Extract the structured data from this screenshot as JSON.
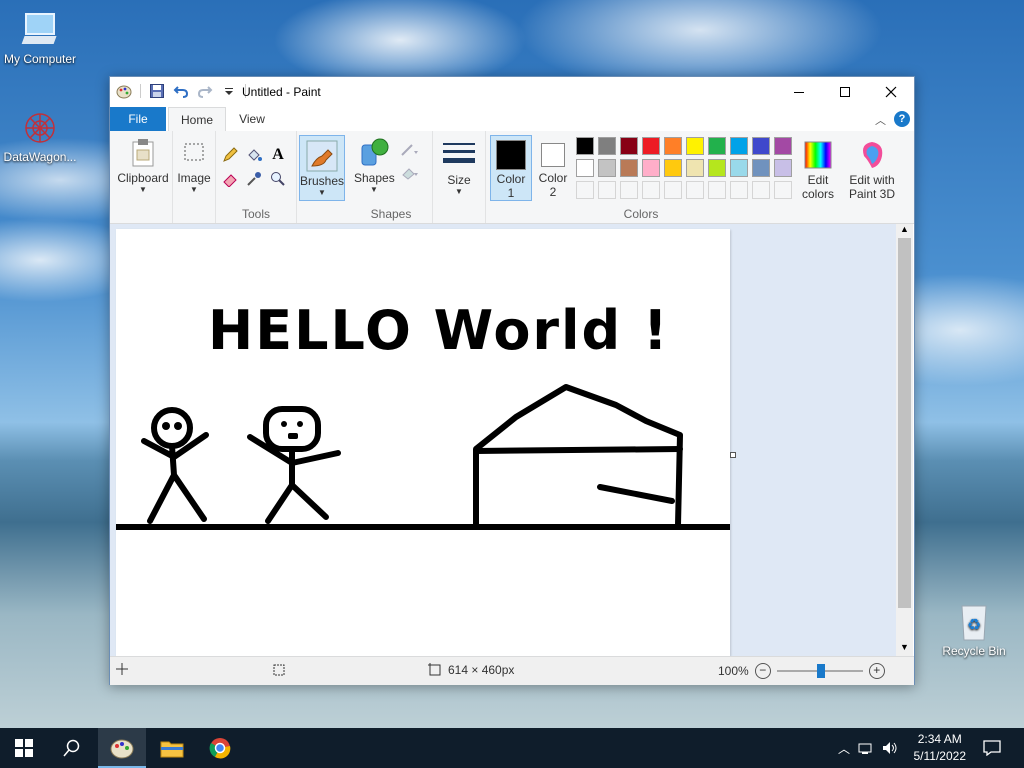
{
  "desktop": {
    "icons": [
      {
        "label": "My Computer"
      },
      {
        "label": "DataWagon..."
      },
      {
        "label": "Recycle Bin"
      }
    ]
  },
  "window": {
    "title": "Untitled - Paint",
    "tabs": [
      "File",
      "Home",
      "View"
    ],
    "ribbon": {
      "clipboard": "Clipboard",
      "image": "Image",
      "tools_label": "Tools",
      "brushes": "Brushes",
      "shapes": "Shapes",
      "shapes_group": "Shapes",
      "size": "Size",
      "color1": "Color\n1",
      "color1_a": "Color",
      "color1_b": "1",
      "color2_a": "Color",
      "color2_b": "2",
      "edit_colors_a": "Edit",
      "edit_colors_b": "colors",
      "edit3d_a": "Edit with",
      "edit3d_b": "Paint 3D",
      "colors_group": "Colors",
      "color1_value": "#000000",
      "color2_value": "#ffffff",
      "palette_row1": [
        "#000000",
        "#7f7f7f",
        "#880015",
        "#ed1c24",
        "#ff7f27",
        "#fff200",
        "#22b14c",
        "#00a2e8",
        "#3f48cc",
        "#a349a4"
      ],
      "palette_row2": [
        "#ffffff",
        "#c3c3c3",
        "#b97a57",
        "#ffaec9",
        "#ffc90e",
        "#efe4b0",
        "#b5e61d",
        "#99d9ea",
        "#7092be",
        "#c8bfe7"
      ]
    },
    "canvas": {
      "text": "HELLO World !"
    },
    "status": {
      "dimensions": "614 × 460px",
      "zoom": "100%"
    }
  },
  "taskbar": {
    "time": "2:34 AM",
    "date": "5/11/2022"
  }
}
